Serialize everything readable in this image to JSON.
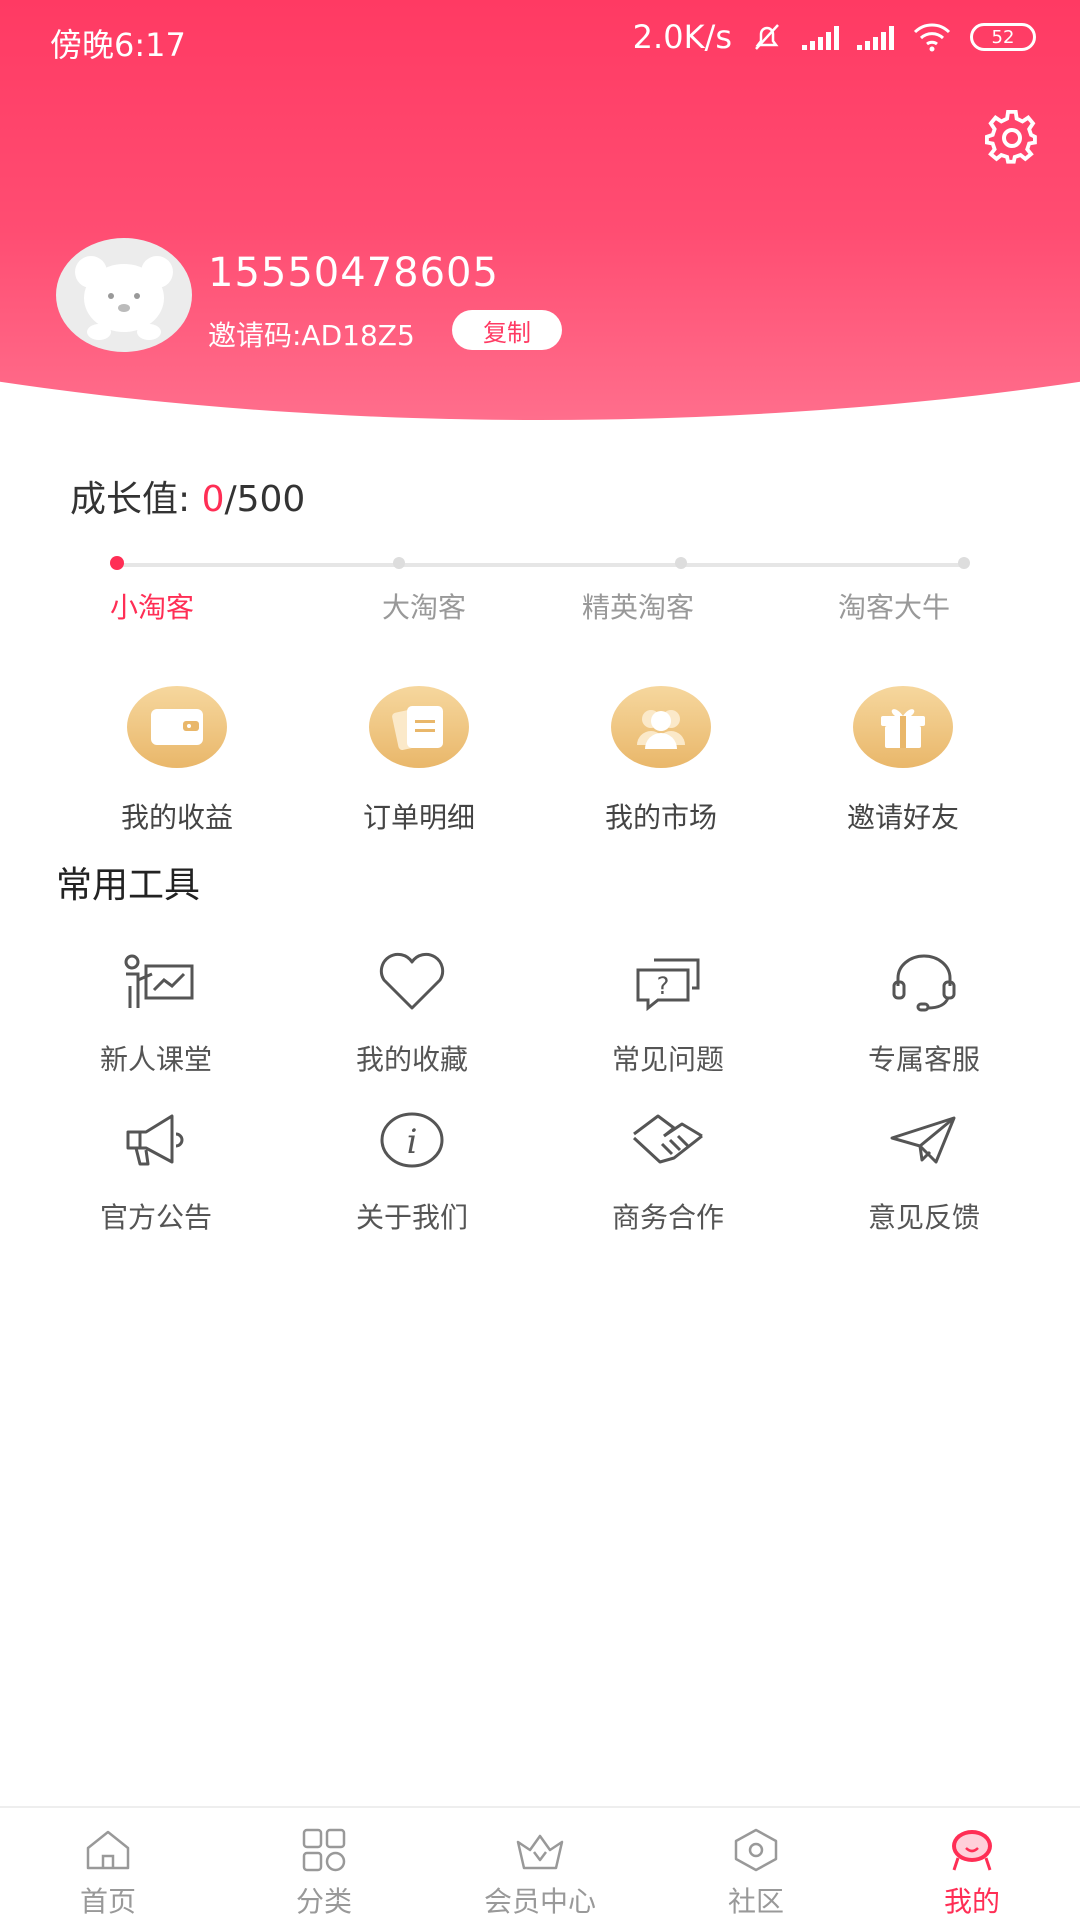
{
  "status_bar": {
    "time": "傍晚6:17",
    "speed": "2.0K/s",
    "battery": "52"
  },
  "profile": {
    "phone": "15550478605",
    "invite_code": "邀请码:AD18Z5",
    "copy_label": "复制"
  },
  "growth": {
    "label": "成长值: ",
    "current": "0",
    "total": "/500",
    "levels": [
      "小淘客",
      "大淘客",
      "精英淘客",
      "淘客大牛"
    ]
  },
  "quick_actions": [
    {
      "label": "我的收益",
      "icon": "wallet-icon"
    },
    {
      "label": "订单明细",
      "icon": "order-list-icon"
    },
    {
      "label": "我的市场",
      "icon": "users-icon"
    },
    {
      "label": "邀请好友",
      "icon": "gift-icon"
    }
  ],
  "tools": {
    "title": "常用工具",
    "items": [
      {
        "label": "新人课堂",
        "icon": "teacher-board-icon"
      },
      {
        "label": "我的收藏",
        "icon": "heart-icon"
      },
      {
        "label": "常见问题",
        "icon": "question-chat-icon"
      },
      {
        "label": "专属客服",
        "icon": "headset-icon"
      },
      {
        "label": "官方公告",
        "icon": "megaphone-icon"
      },
      {
        "label": "关于我们",
        "icon": "info-icon"
      },
      {
        "label": "商务合作",
        "icon": "handshake-icon"
      },
      {
        "label": "意见反馈",
        "icon": "paper-plane-icon"
      }
    ]
  },
  "bottom_nav": [
    {
      "label": "首页",
      "icon": "home-icon"
    },
    {
      "label": "分类",
      "icon": "grid-icon"
    },
    {
      "label": "会员中心",
      "icon": "crown-icon"
    },
    {
      "label": "社区",
      "icon": "hexagon-icon"
    },
    {
      "label": "我的",
      "icon": "profile-face-icon",
      "active": true
    }
  ],
  "colors": {
    "accent": "#ff2e55",
    "header_top": "#ff3a63",
    "gold": "#e9b76a"
  }
}
